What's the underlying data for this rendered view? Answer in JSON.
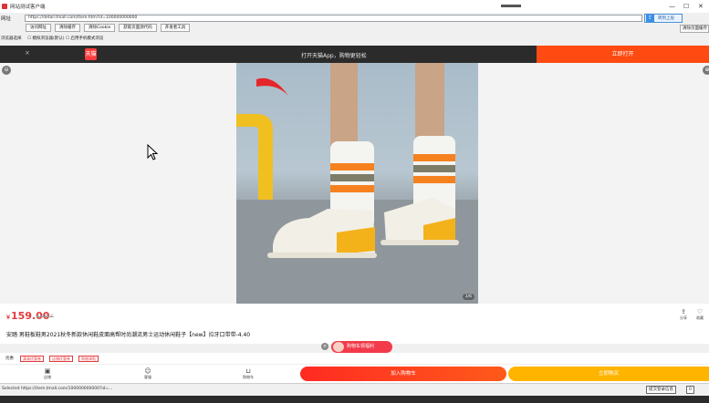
{
  "window": {
    "title": "网站测试客户端",
    "minimize": "—",
    "maximize": "☐",
    "close": "✕"
  },
  "address": {
    "label": "网址",
    "url": "https://detail.tmall.com/item.htm?id=100000000000",
    "go_label": "转到上层"
  },
  "toolbar": {
    "buttons": [
      "访问网址",
      "清除缓存",
      "清除Cookie",
      "获取页面源代码",
      "开发者工具"
    ],
    "side_button": "清除页面缓存"
  },
  "options": {
    "label": "浏览器选择",
    "value": "☐ 模拟浏览器(默认)   ☐ 启用手机模式浏览"
  },
  "banner": {
    "close": "×",
    "logo": "天猫",
    "message": "打开天猫App，购物更轻松",
    "open_button": "立即打开"
  },
  "media": {
    "left_icon": "⊖",
    "right_icon": "⊕",
    "badge": "1/6"
  },
  "product": {
    "currency": "￥",
    "price": "159.00",
    "old_price": "¥329.00",
    "title": "安踏 男鞋板鞋男2021秋冬新款休闲鞋皮面高帮时尚潮流男士运动休闲鞋子【new】拉牙口带带-4.40",
    "share_label": "分享",
    "collect_label": "收藏"
  },
  "float": {
    "close": "×",
    "label": "购物车领福利"
  },
  "coupons": {
    "label": "优惠",
    "items": [
      "满减优惠券",
      "店铺优惠券",
      "购物津贴"
    ]
  },
  "bottom_bar": {
    "store": "店铺",
    "service": "客服",
    "cart": "购物车",
    "add_to_cart": "加入购物车",
    "buy_now": "立即购买"
  },
  "status": {
    "text": "Selected https://item.tmall.com/100000000000?id=...",
    "btn1": "提交登录信息",
    "btn2": "0"
  },
  "colors": {
    "accent": "#ff4a12",
    "price": "#e4393c",
    "buy": "#ffb400",
    "banner_bg": "#2b2b2b"
  }
}
